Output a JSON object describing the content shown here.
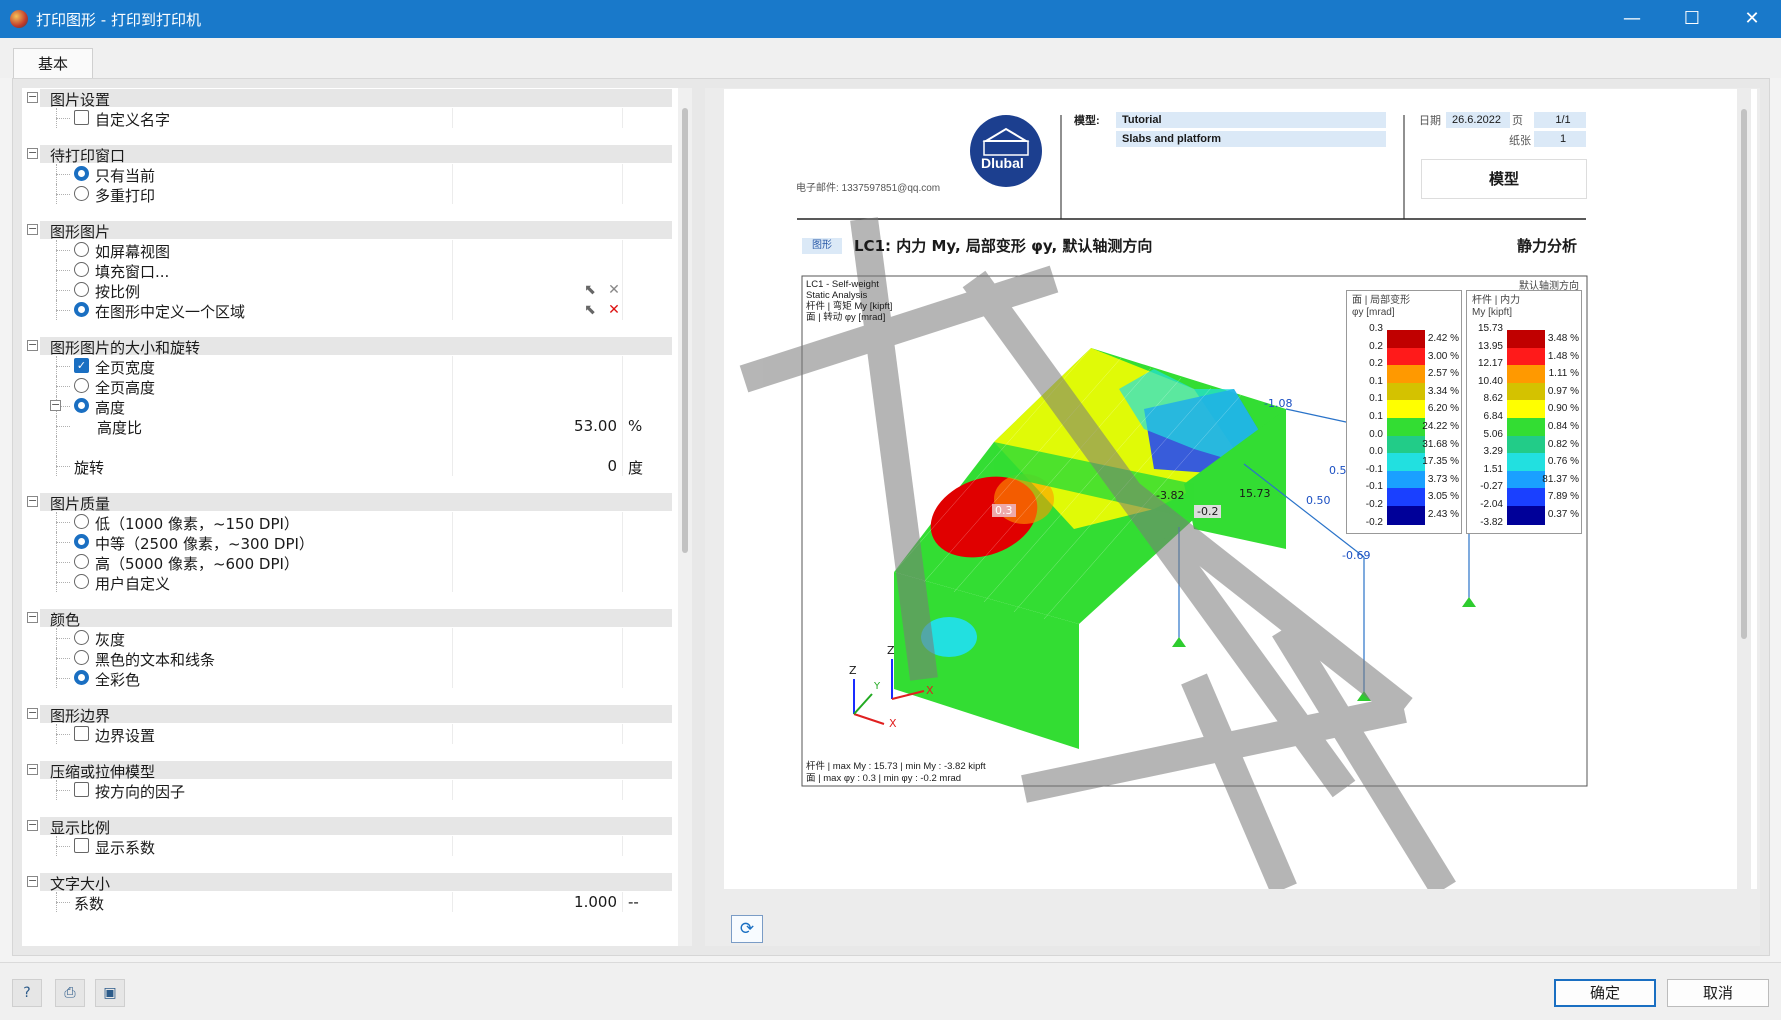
{
  "window": {
    "title": "打印图形 - 打印到打印机",
    "minimize": "—",
    "maximize": "☐",
    "close": "✕"
  },
  "tabs": [
    {
      "label": "基本",
      "active": true
    }
  ],
  "groups": [
    {
      "label": "图片设置",
      "items": [
        {
          "type": "check",
          "label": "自定义名字",
          "checked": false
        }
      ]
    },
    {
      "label": "待打印窗口",
      "items": [
        {
          "type": "radio",
          "label": "只有当前",
          "checked": true
        },
        {
          "type": "radio",
          "label": "多重打印",
          "checked": false
        }
      ]
    },
    {
      "label": "图形图片",
      "items": [
        {
          "type": "radio",
          "label": "如屏幕视图",
          "checked": false
        },
        {
          "type": "radio",
          "label": "填充窗口...",
          "checked": false
        },
        {
          "type": "radio",
          "label": "按比例",
          "checked": false,
          "actions": [
            "pick-icon",
            "delete-icon-grey"
          ]
        },
        {
          "type": "radio",
          "label": "在图形中定义一个区域",
          "checked": true,
          "actions": [
            "pick-icon",
            "delete-icon-red"
          ]
        }
      ]
    },
    {
      "label": "图形图片的大小和旋转",
      "items": [
        {
          "type": "check",
          "label": "全页宽度",
          "checked": true
        },
        {
          "type": "radio",
          "label": "全页高度",
          "checked": false
        },
        {
          "type": "radio",
          "label": "高度",
          "checked": true,
          "sub": true
        },
        {
          "type": "value",
          "label": "高度比",
          "value": "53.00",
          "unit": "%"
        },
        {
          "type": "blank"
        },
        {
          "type": "value",
          "label": "旋转",
          "value": "0",
          "unit": "度"
        }
      ]
    },
    {
      "label": "图片质量",
      "items": [
        {
          "type": "radio",
          "label": "低（1000 像素，~150 DPI）",
          "checked": false
        },
        {
          "type": "radio",
          "label": "中等（2500 像素，~300 DPI）",
          "checked": true
        },
        {
          "type": "radio",
          "label": "高（5000 像素，~600 DPI）",
          "checked": false
        },
        {
          "type": "radio",
          "label": "用户自定义",
          "checked": false
        }
      ]
    },
    {
      "label": "颜色",
      "items": [
        {
          "type": "radio",
          "label": "灰度",
          "checked": false
        },
        {
          "type": "radio",
          "label": "黑色的文本和线条",
          "checked": false
        },
        {
          "type": "radio",
          "label": "全彩色",
          "checked": true
        }
      ]
    },
    {
      "label": "图形边界",
      "items": [
        {
          "type": "check",
          "label": "边界设置",
          "checked": false
        }
      ]
    },
    {
      "label": "压缩或拉伸模型",
      "items": [
        {
          "type": "check",
          "label": "按方向的因子",
          "checked": false
        }
      ]
    },
    {
      "label": "显示比例",
      "items": [
        {
          "type": "check",
          "label": "显示系数",
          "checked": false
        }
      ]
    },
    {
      "label": "文字大小",
      "items": [
        {
          "type": "value",
          "label": "系数",
          "value": "1.000",
          "unit": "--"
        }
      ]
    }
  ],
  "preview": {
    "logo_text": "Dlubal",
    "email": "电子邮件: 1337597851@qq.com",
    "model_label": "模型:",
    "model_name": "Tutorial",
    "model_sub": "Slabs and platform",
    "date_label": "日期",
    "date_value": "26.6.2022",
    "page_label": "页",
    "page_value": "1/1",
    "sheet_label": "纸张",
    "sheet_value": "1",
    "section_box": "模型",
    "figure_tag": "图形",
    "figure_title": "LC1: 内力 My, 局部变形 φy, 默认轴测方向",
    "analysis_type": "静力分析",
    "view_dir": "默认轴测方向",
    "info_lines": [
      "LC1 - Self-weight",
      "Static Analysis",
      "杆件 | 弯矩 My [kipft]",
      "面 | 转动 φy [mrad]"
    ],
    "footer_lines": [
      "杆件 | max My : 15.73 | min My : -3.82 kipft",
      "面 | max φy : 0.3 | min φy : -0.2 mrad"
    ],
    "plot_labels": [
      "-1.08",
      "0.50",
      "0.50",
      "-3.82",
      "-0.2",
      "15.73",
      "-0.69",
      "0.3"
    ],
    "axis_labels": [
      "Z",
      "Y",
      "X",
      "Z",
      "X"
    ],
    "legend1": {
      "title1": "面 | 局部变形",
      "title2": "φy [mrad]",
      "levels": [
        "0.3",
        "0.2",
        "0.2",
        "0.1",
        "0.1",
        "0.1",
        "0.0",
        "0.0",
        "-0.1",
        "-0.1",
        "-0.2",
        "-0.2"
      ],
      "percents": [
        "2.42 %",
        "3.00 %",
        "2.57 %",
        "3.34 %",
        "6.20 %",
        "24.22 %",
        "31.68 %",
        "17.35 %",
        "3.73 %",
        "3.05 %",
        "2.43 %"
      ]
    },
    "legend2": {
      "title1": "杆件 | 内力",
      "title2": "My [kipft]",
      "levels": [
        "15.73",
        "13.95",
        "12.17",
        "10.40",
        "8.62",
        "6.84",
        "5.06",
        "3.29",
        "1.51",
        "-0.27",
        "-2.04",
        "-3.82"
      ],
      "percents": [
        "3.48 %",
        "1.48 %",
        "1.11 %",
        "0.97 %",
        "0.90 %",
        "0.84 %",
        "0.82 %",
        "0.76 %",
        "81.37 %",
        "7.89 %",
        "0.37 %"
      ]
    },
    "legend_colors": [
      "#c00000",
      "#ff1a1a",
      "#ff9900",
      "#d4c200",
      "#ffff00",
      "#33dd33",
      "#22cc88",
      "#22e0e0",
      "#1aa0ff",
      "#1a40ff",
      "#000099"
    ]
  },
  "bottom": {
    "ok_label": "确定",
    "cancel_label": "取消",
    "tool_icons": [
      "help-icon",
      "print-settings-icon",
      "save-icon"
    ]
  }
}
